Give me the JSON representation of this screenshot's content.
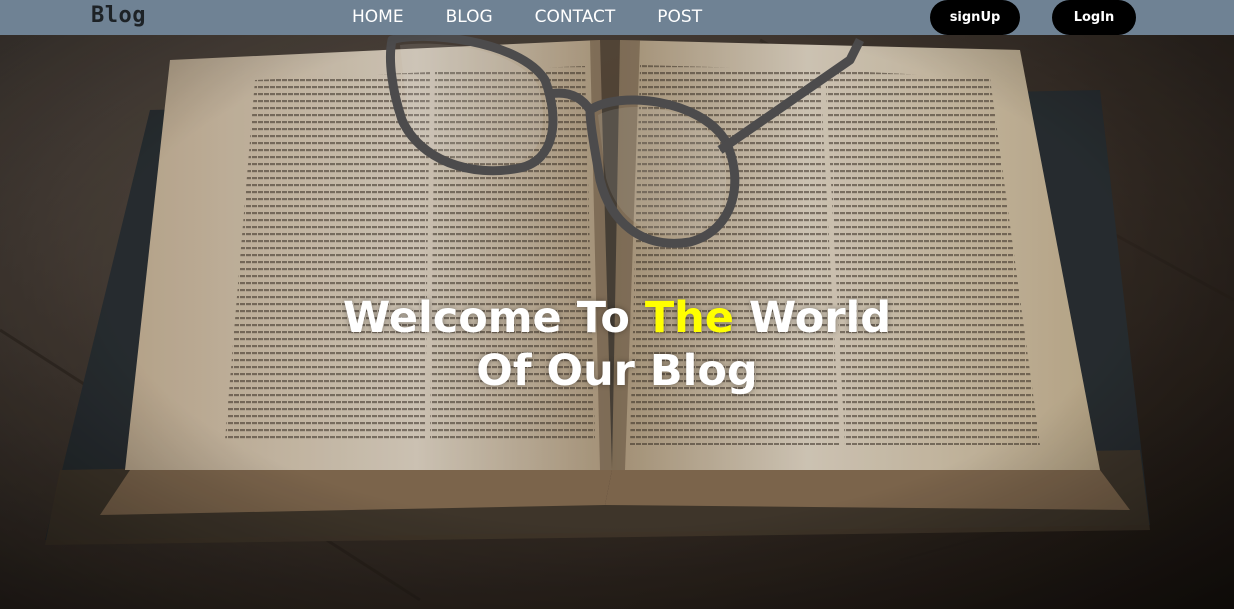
{
  "navbar": {
    "brand": "Blog",
    "links": [
      {
        "label": "HOME"
      },
      {
        "label": "BLOG"
      },
      {
        "label": "CONTACT"
      },
      {
        "label": "POST"
      }
    ],
    "signup_label": "signUp",
    "login_label": "LogIn"
  },
  "hero": {
    "title_part1": "Welcome To ",
    "title_highlight": "The",
    "title_part2": " World",
    "title_line2": "Of Our Blog"
  },
  "colors": {
    "navbar_bg": "#6f8294",
    "button_bg": "#000000",
    "highlight": "#ffff00",
    "hero_text": "#ffffff"
  }
}
